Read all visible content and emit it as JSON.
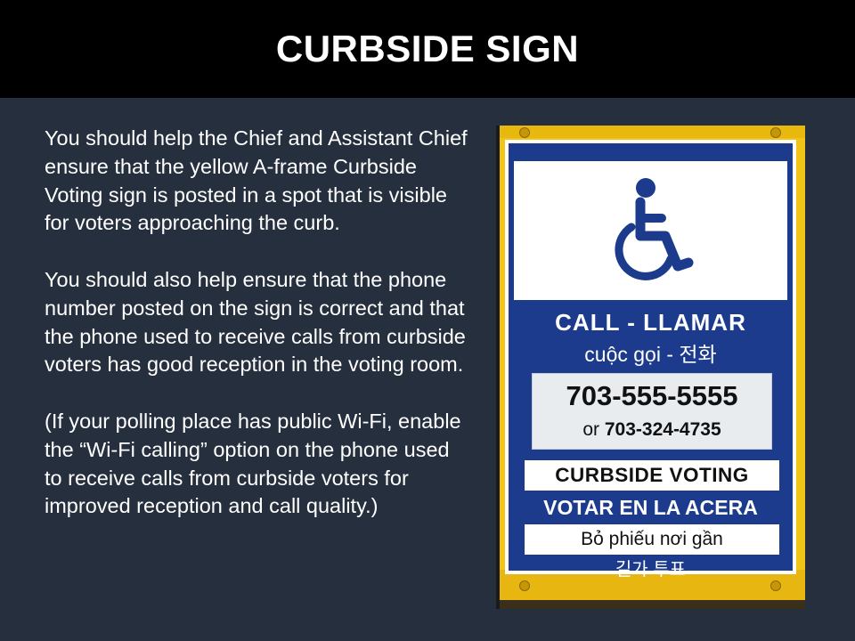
{
  "slide": {
    "title": "CURBSIDE SIGN",
    "paragraphs": [
      "You should help the Chief and Assistant Chief ensure that the yellow A-frame Curbside Voting sign is posted in a spot that is visible for voters approaching the curb.",
      "You should also help ensure that the phone number posted on the sign is correct and that the phone used to receive calls from curbside voters has good reception in the voting room.",
      "(If your polling place has public Wi-Fi, enable the “Wi-Fi calling” option on the phone used to receive calls from curbside voters for improved reception and call quality.)"
    ]
  },
  "sign": {
    "icon": "wheelchair-icon",
    "call_line": "CALL - LLAMAR",
    "call_line_translations": "cuộc gọi - 전화",
    "phone_primary": "703-555-5555",
    "phone_alt_prefix": "or",
    "phone_alt": "703-324-4735",
    "curbside_voting": "CURBSIDE VOTING",
    "votar": "VOTAR EN LA ACERA",
    "vietnamese": "Bỏ phiếu nơi gần",
    "korean": "길가 투표"
  },
  "colors": {
    "slide_background": "#262f3d",
    "title_bar": "#000000",
    "sign_frame_yellow": "#f3c418",
    "sign_blue": "#1c3b8c"
  }
}
